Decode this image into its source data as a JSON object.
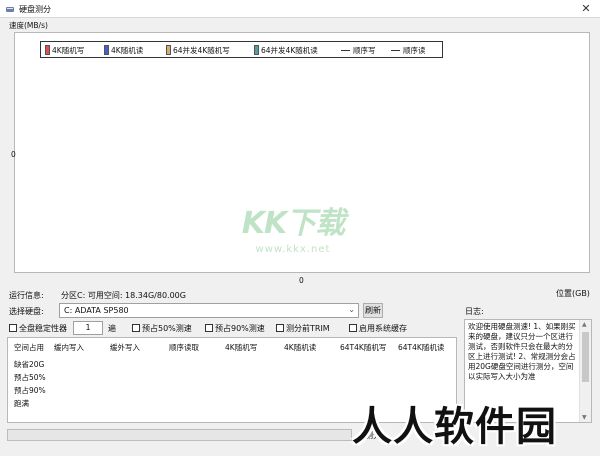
{
  "window": {
    "title": "硬盘测分",
    "close_glyph": "✕"
  },
  "chart": {
    "speed_label": "速度(MB/s)",
    "y_zero": "0",
    "x_zero": "0",
    "position_label": "位置(GB)",
    "legend": [
      {
        "label": "4K随机写",
        "color": "#e05050",
        "kind": "box"
      },
      {
        "label": "4K随机读",
        "color": "#4a5ec8",
        "kind": "box"
      },
      {
        "label": "64并发4K随机写",
        "color": "#d0b070",
        "kind": "box"
      },
      {
        "label": "64并发4K随机读",
        "color": "#50a0a0",
        "kind": "box"
      },
      {
        "label": "顺序写",
        "color": "#333333",
        "kind": "line"
      },
      {
        "label": "顺序读",
        "color": "#333333",
        "kind": "line"
      }
    ]
  },
  "watermark": {
    "text": "KK下载",
    "url": "www.kkx.net"
  },
  "info": {
    "run_label": "运行信息:",
    "run_value": "分区C: 可用空间: 18.34G/80.00G",
    "select_label": "选择硬盘:",
    "select_value": "C: ADATA SP580",
    "refresh_label": "刷新"
  },
  "options": {
    "stability_label": "全盘稳定性器",
    "count_value": "1",
    "count_unit": "遍",
    "prefill50_label": "预占50%测速",
    "prefill90_label": "预占90%测速",
    "trim_label": "测分前TRIM",
    "cache_label": "启用系统缓存"
  },
  "table": {
    "headers": [
      "空间占用",
      "缓内写入",
      "缓外写入",
      "顺序读取",
      "4K随机写",
      "4K随机读",
      "64T4K随机写",
      "64T4K随机读"
    ],
    "rows": [
      "缺省20G",
      "预占50%",
      "预占90%",
      "跑满"
    ]
  },
  "log": {
    "label": "日志:",
    "text": "欢迎使用硬盘测速! 1、如果刚买来的硬盘，建议只分一个区进行测试，否则软件只会在最大的分区上进行测试! 2、常规测分会占用20G硬盘空间进行测分，空间以实际写入大小为准"
  },
  "progress": {
    "value": 0,
    "start_label": "测分"
  },
  "site_watermark": "人人软件园"
}
